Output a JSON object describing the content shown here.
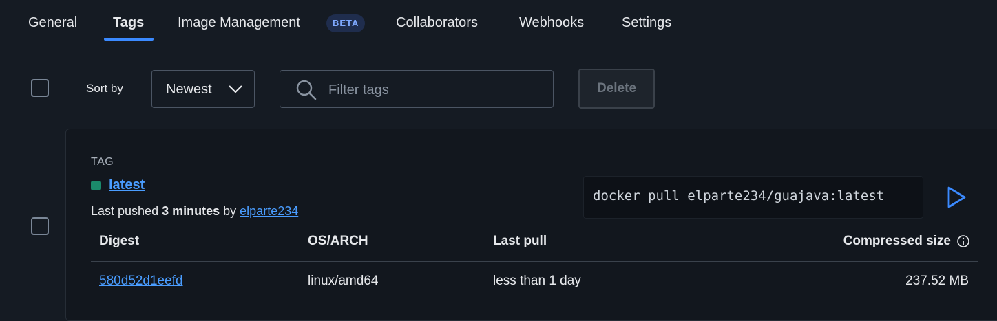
{
  "tabs": [
    {
      "label": "General"
    },
    {
      "label": "Tags"
    },
    {
      "label": "Image Management"
    },
    {
      "label": "Collaborators"
    },
    {
      "label": "Webhooks"
    },
    {
      "label": "Settings"
    }
  ],
  "beta_badge": "BETA",
  "active_tab": "Tags",
  "toolbar": {
    "sort_label": "Sort by",
    "sort_value": "Newest",
    "filter_placeholder": "Filter tags",
    "delete_label": "Delete"
  },
  "tag_card": {
    "section_label": "TAG",
    "tag_name": "latest",
    "pushed_prefix": "Last pushed",
    "pushed_time": "3 minutes",
    "pushed_by_word": "by",
    "pushed_user": "elparte234",
    "pull_command": "docker pull elparte234/guajava:latest",
    "columns": [
      "Digest",
      "OS/ARCH",
      "Last pull",
      "Compressed size"
    ],
    "rows": [
      {
        "digest": "580d52d1eefd",
        "os_arch": "linux/amd64",
        "last_pull": "less than 1 day",
        "size": "237.52 MB"
      }
    ]
  },
  "icons": {
    "sort": "chevron-down-icon",
    "filter": "search-icon",
    "run": "play-icon",
    "size_info": "info-icon"
  },
  "colors": {
    "background": "#151b23",
    "accent": "#3b8aff",
    "link": "#4a9dff",
    "status": "#1b8a6b"
  }
}
